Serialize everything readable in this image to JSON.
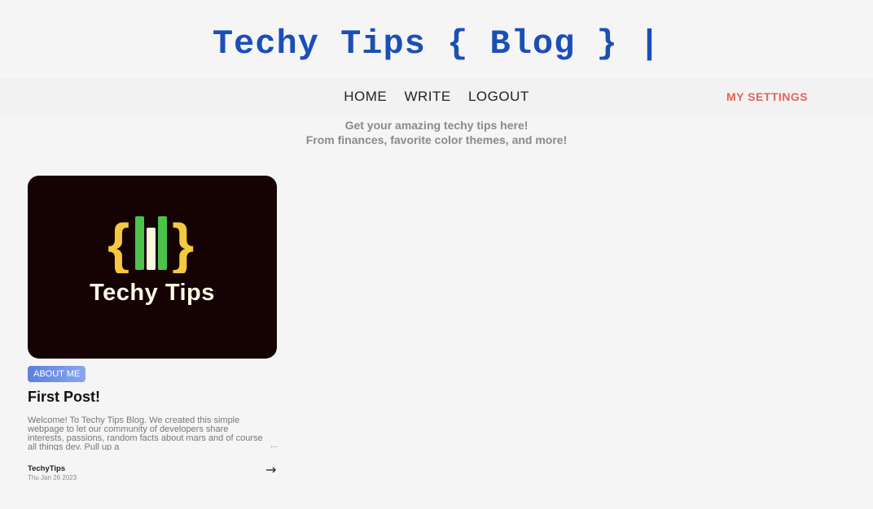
{
  "header": {
    "title": "Techy Tips { Blog } |"
  },
  "nav": {
    "items": [
      "HOME",
      "WRITE",
      "LOGOUT"
    ],
    "settings": "MY SETTINGS"
  },
  "tagline": {
    "line1": "Get your amazing techy tips here!",
    "line2": "From finances, favorite color themes, and more!"
  },
  "posts": [
    {
      "image_text": "Techy Tips",
      "category": "ABOUT ME",
      "title": "First Post!",
      "excerpt": "Welcome! To Techy Tips Blog. We created this simple webpage to let our community of developers share interests, passions, random facts about mars and of course all things dev. Pull up a",
      "ellipsis": "...",
      "author": "TechyTips",
      "date": "Thu Jan 26 2023"
    }
  ],
  "colors": {
    "title": "#1a4fb8",
    "settings": "#e0655e",
    "card_bg": "#150303",
    "logo_braces": "#f5c842",
    "logo_green": "#4cc24a"
  },
  "icons": {
    "read_more": "arrow-right-icon"
  }
}
